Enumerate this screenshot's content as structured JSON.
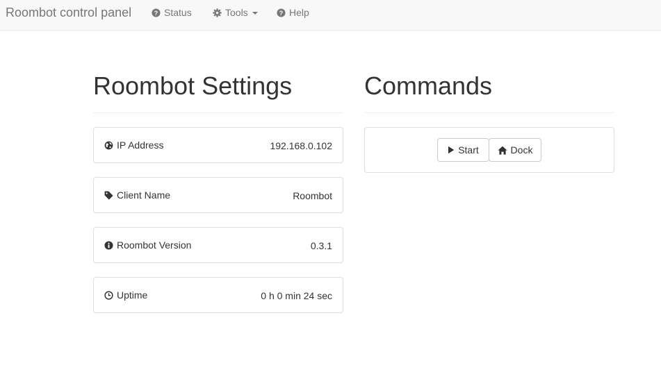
{
  "navbar": {
    "brand": "Roombot control panel",
    "items": [
      {
        "label": "Status",
        "icon": "question-circle-icon"
      },
      {
        "label": "Tools",
        "icon": "gear-icon"
      },
      {
        "label": "Help",
        "icon": "question-circle-icon"
      }
    ]
  },
  "settings": {
    "title": "Roombot Settings",
    "rows": [
      {
        "icon": "globe-icon",
        "label": "IP Address",
        "value": "192.168.0.102"
      },
      {
        "icon": "tag-icon",
        "label": "Client Name",
        "value": "Roombot"
      },
      {
        "icon": "info-circle-icon",
        "label": "Roombot Version",
        "value": "0.3.1"
      },
      {
        "icon": "clock-icon",
        "label": "Uptime",
        "value": "0 h 0 min 24 sec"
      }
    ]
  },
  "commands": {
    "title": "Commands",
    "buttons": [
      {
        "label": "Start",
        "icon": "play-icon"
      },
      {
        "label": "Dock",
        "icon": "home-icon"
      }
    ]
  },
  "colors": {
    "navbar_bg": "#f8f8f8",
    "nav_text": "#777777",
    "text": "#333333",
    "border": "#dddddd"
  }
}
